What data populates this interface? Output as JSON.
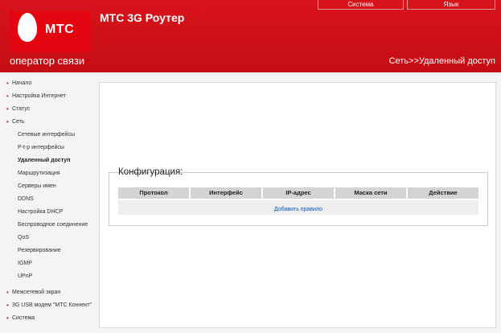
{
  "header": {
    "logo_text": "МТС",
    "slogan": "оператор связи",
    "router_title": "МТС 3G Роутер",
    "top_tabs": [
      "Система",
      "Язык"
    ],
    "breadcrumb": "Сеть>>Удаленный доступ"
  },
  "sidebar": {
    "items": [
      {
        "label": "Начало",
        "level": "top"
      },
      {
        "label": "Настройка Интернет",
        "level": "top"
      },
      {
        "label": "Статус",
        "level": "top"
      },
      {
        "label": "Сеть",
        "level": "top"
      },
      {
        "label": "Сетевые интерфейсы",
        "level": "sub"
      },
      {
        "label": "P-t-p интерфейсы",
        "level": "sub"
      },
      {
        "label": "Удаленный доступ",
        "level": "sub",
        "active": true
      },
      {
        "label": "Маршрутизация",
        "level": "sub"
      },
      {
        "label": "Серверы имен",
        "level": "sub"
      },
      {
        "label": "DDNS",
        "level": "sub"
      },
      {
        "label": "Настройка DHCP",
        "level": "sub"
      },
      {
        "label": "Беспроводное соединение",
        "level": "sub"
      },
      {
        "label": "QoS",
        "level": "sub"
      },
      {
        "label": "Резервирование",
        "level": "sub"
      },
      {
        "label": "IGMP",
        "level": "sub"
      },
      {
        "label": "UPnP",
        "level": "sub"
      },
      {
        "label": "Межсетевой экран",
        "level": "top"
      },
      {
        "label": "3G USB модем \"МТС Коннект\"",
        "level": "top"
      },
      {
        "label": "Система",
        "level": "top"
      }
    ]
  },
  "main": {
    "section_title": "Конфигурация:",
    "columns": [
      "Протокол",
      "Интерфейс",
      "IP-адрес",
      "Маска сети",
      "Действие"
    ],
    "add_rule": "Добавить правило"
  }
}
